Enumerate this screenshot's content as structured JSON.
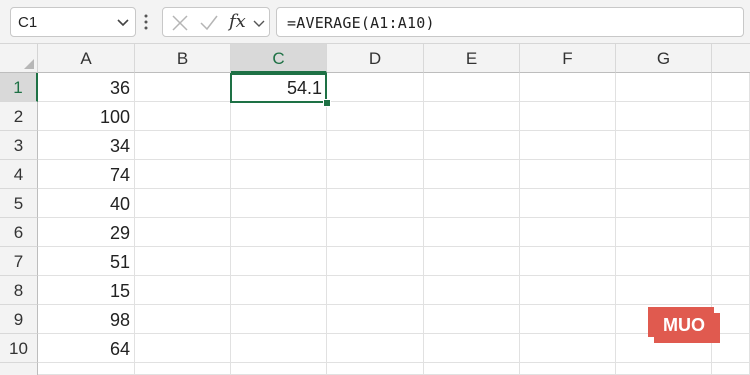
{
  "name_box": {
    "value": "C1"
  },
  "formula_bar": {
    "value": "=AVERAGE(A1:A10)",
    "fx_label": "fx"
  },
  "columns": [
    "A",
    "B",
    "C",
    "D",
    "E",
    "F",
    "G"
  ],
  "selected_column": "C",
  "rows": [
    "1",
    "2",
    "3",
    "4",
    "5",
    "6",
    "7",
    "8",
    "9",
    "10"
  ],
  "selected_row": "1",
  "cells": {
    "A1": "36",
    "A2": "100",
    "A3": "34",
    "A4": "74",
    "A5": "40",
    "A6": "29",
    "A7": "51",
    "A8": "15",
    "A9": "98",
    "A10": "64",
    "C1": "54.1"
  },
  "watermark": {
    "text": "MUO",
    "color": "#e05a4f"
  },
  "colors": {
    "accent": "#1e7145",
    "header_bg": "#f3f3f3",
    "selected_header_bg": "#d9d9d9"
  }
}
